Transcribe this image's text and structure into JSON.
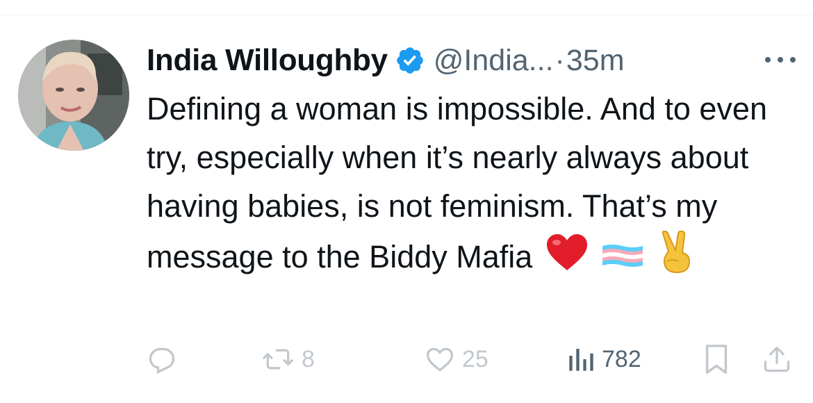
{
  "tweet": {
    "author_name": "India Willoughby",
    "handle": "@India...",
    "separator": "·",
    "time": "35m",
    "text": "Defining a woman is impossible. And to even try, especially when it’s nearly always about having babies, is not feminism. That’s my message to the Biddy Mafia",
    "emojis": [
      "red-heart",
      "transgender-flag",
      "victory-hand"
    ]
  },
  "actions": {
    "reply_count": "",
    "retweet_count": "8",
    "like_count": "25",
    "views_count": "782"
  },
  "colors": {
    "verified_blue": "#1d9bf0",
    "muted_text": "#536471",
    "text": "#0f1419"
  }
}
